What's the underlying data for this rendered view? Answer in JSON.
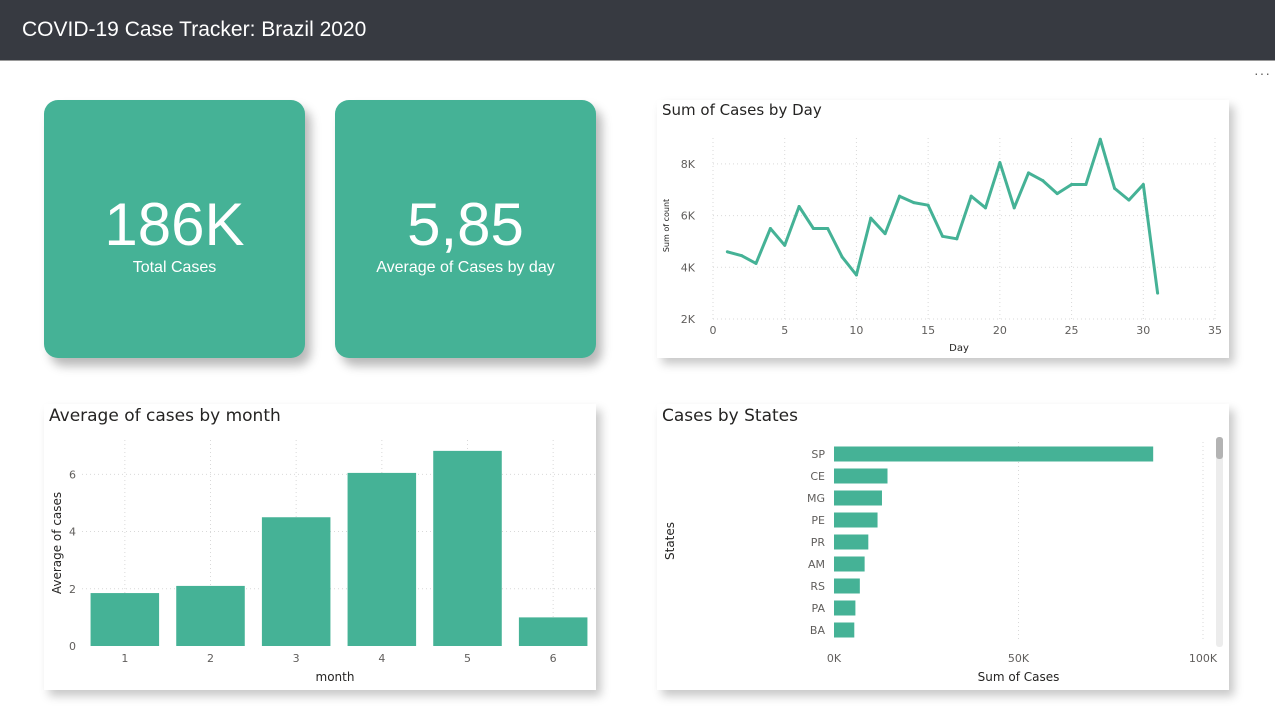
{
  "header": {
    "title": "COVID-19 Case Tracker: Brazil 2020"
  },
  "more_icon": "more-options-icon",
  "more_glyph": "···",
  "colors": {
    "accent": "#45b296",
    "header_bg": "#373a41"
  },
  "kpis": [
    {
      "value": "186K",
      "label": "Total Cases"
    },
    {
      "value": "5,85",
      "label": "Average of Cases by day"
    }
  ],
  "chart_data": [
    {
      "id": "line",
      "type": "line",
      "title": "Sum of Cases by Day",
      "xlabel": "Day",
      "ylabel": "Sum of count",
      "xlim": [
        0,
        35
      ],
      "ylim": [
        2000,
        9000
      ],
      "xticks": [
        0,
        5,
        10,
        15,
        20,
        25,
        30,
        35
      ],
      "yticks": [
        2000,
        4000,
        6000,
        8000
      ],
      "ytick_labels": [
        "2K",
        "4K",
        "6K",
        "8K"
      ],
      "grid": true,
      "x": [
        1,
        2,
        3,
        4,
        5,
        6,
        7,
        8,
        9,
        10,
        11,
        12,
        13,
        14,
        15,
        16,
        17,
        18,
        19,
        20,
        21,
        22,
        23,
        24,
        25,
        26,
        27,
        28,
        29,
        30,
        31
      ],
      "values": [
        4600,
        4450,
        4150,
        5500,
        4850,
        6350,
        5500,
        5500,
        4400,
        3700,
        5900,
        5300,
        6750,
        6500,
        6400,
        5200,
        5100,
        6750,
        6300,
        8050,
        6300,
        7650,
        7350,
        6850,
        7200,
        7200,
        8950,
        7050,
        6600,
        7200,
        3000
      ]
    },
    {
      "id": "month",
      "type": "bar",
      "title": "Average of cases by month",
      "xlabel": "month",
      "ylabel": "Average of cases",
      "categories": [
        "1",
        "2",
        "3",
        "4",
        "5",
        "6"
      ],
      "values": [
        1.85,
        2.1,
        4.5,
        6.05,
        6.82,
        1.0
      ],
      "ylim": [
        0,
        7.2
      ],
      "yticks": [
        0,
        2,
        4,
        6
      ],
      "grid": true
    },
    {
      "id": "states",
      "type": "bar",
      "orientation": "horizontal",
      "title": "Cases by States",
      "xlabel": "Sum of Cases",
      "ylabel": "States",
      "categories": [
        "SP",
        "CE",
        "MG",
        "PE",
        "PR",
        "AM",
        "RS",
        "PA",
        "BA"
      ],
      "values": [
        86500,
        14500,
        13000,
        11800,
        9300,
        8300,
        7000,
        5800,
        5500
      ],
      "xlim": [
        0,
        100000
      ],
      "xticks": [
        0,
        50000,
        100000
      ],
      "xtick_labels": [
        "0K",
        "50K",
        "100K"
      ],
      "grid": true
    }
  ]
}
